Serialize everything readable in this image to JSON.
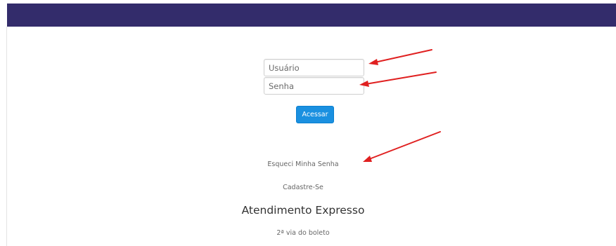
{
  "header": {
    "background_color": "#332c6b"
  },
  "login_form": {
    "username_placeholder": "Usuário",
    "password_placeholder": "Senha",
    "submit_label": "Acessar",
    "submit_color": "#1a90e0"
  },
  "links": {
    "forgot_password": "Esqueci Minha Senha",
    "signup": "Cadastre-Se"
  },
  "express_service": {
    "title": "Atendimento Expresso",
    "boleto_link": "2ª via do boleto"
  },
  "annotations": {
    "arrow_color": "#e02020",
    "arrow_count": 3
  }
}
